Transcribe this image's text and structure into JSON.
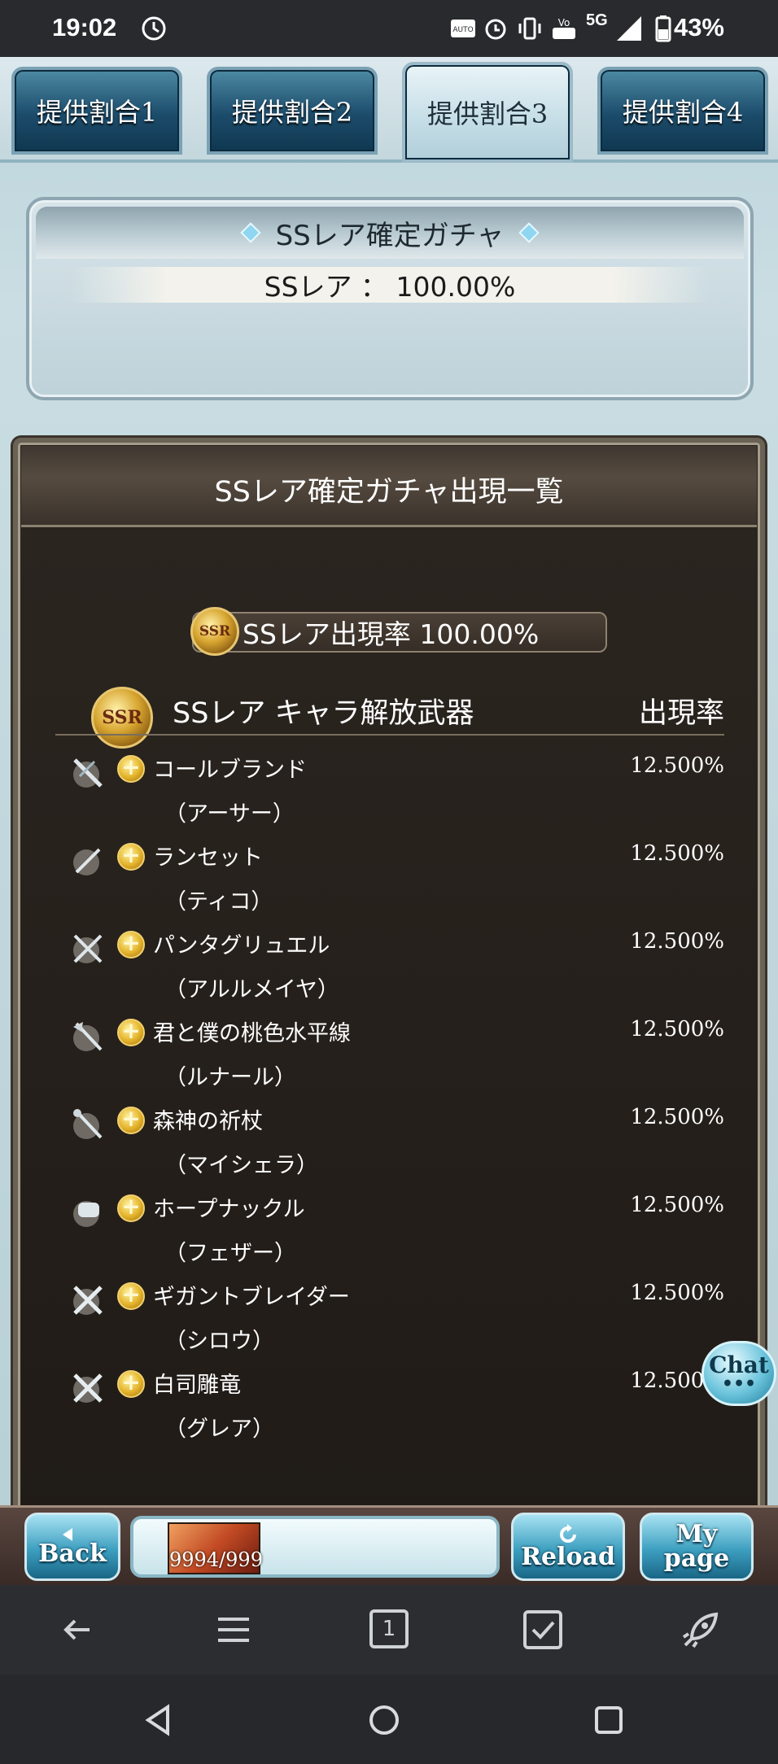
{
  "status_bar": {
    "time": "19:02",
    "network": "5G",
    "battery": "43%"
  },
  "tabs": [
    {
      "label": "提供割合1",
      "active": false
    },
    {
      "label": "提供割合2",
      "active": false
    },
    {
      "label": "提供割合3",
      "active": true
    },
    {
      "label": "提供割合4",
      "active": false
    }
  ],
  "rate_panel": {
    "title": "SSレア確定ガチャ",
    "rate_line": "SSレア ： 100.00%"
  },
  "list_panel": {
    "title": "SSレア確定ガチャ出現一覧",
    "rate_pill": "SSレア出現率 100.00%",
    "badge_small": "SSR",
    "badge_large": "SSR",
    "category": "SSレア キャラ解放武器",
    "rate_header": "出現率",
    "items": [
      {
        "name": "コールブランド",
        "owner": "（アーサー）",
        "rate": "12.500%",
        "icon": "sword-icon"
      },
      {
        "name": "ランセット",
        "owner": "（ティコ）",
        "rate": "12.500%",
        "icon": "lance-icon"
      },
      {
        "name": "パンタグリュエル",
        "owner": "（アルルメイヤ）",
        "rate": "12.500%",
        "icon": "crossed-weapons-icon"
      },
      {
        "name": "君と僕の桃色水平線",
        "owner": "（ルナール）",
        "rate": "12.500%",
        "icon": "axe-icon"
      },
      {
        "name": "森神の祈杖",
        "owner": "（マイシェラ）",
        "rate": "12.500%",
        "icon": "staff-icon"
      },
      {
        "name": "ホープナックル",
        "owner": "（フェザー）",
        "rate": "12.500%",
        "icon": "knuckle-icon"
      },
      {
        "name": "ギガントブレイダー",
        "owner": "（シロウ）",
        "rate": "12.500%",
        "icon": "crossed-swords-icon"
      },
      {
        "name": "白司雕竜",
        "owner": "（グレア）",
        "rate": "12.500%",
        "icon": "crossed-swords-icon"
      }
    ]
  },
  "chat_label": "Chat",
  "footer": {
    "back_label": "Back",
    "ap_text": "9994/999",
    "reload_label": "Reload",
    "mypage_line1": "My",
    "mypage_line2": "page"
  },
  "browser_toolbar": {
    "tab_count": "1"
  },
  "colors": {
    "tab_blue": "#1c4c6b",
    "panel_dark": "#2a241e",
    "gold": "#d7a530",
    "button_cyan": "#3d9fc0"
  }
}
